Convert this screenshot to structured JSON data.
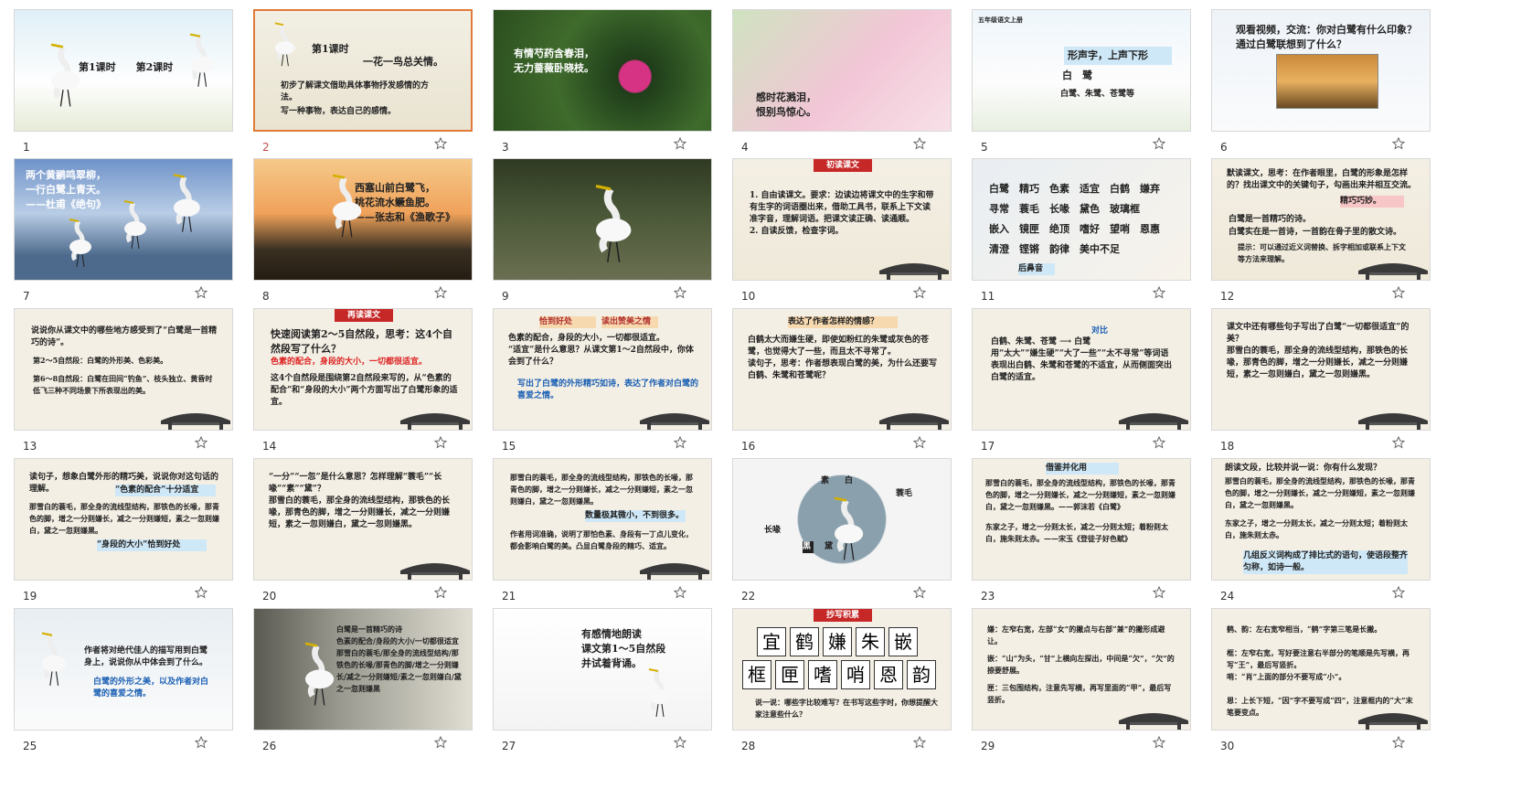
{
  "slides": [
    {
      "num": "1",
      "text": "第1课时　　第2课时"
    },
    {
      "num": "2",
      "title": "第1课时",
      "subtitle": "一花一鸟总关情。",
      "bullets": [
        "初步了解课文借助具体事物抒发感情的方法。",
        "写一种事物，表达自己的感情。"
      ]
    },
    {
      "num": "3",
      "text": "有情芍药含春泪，\n无力蔷薇卧晓枝。"
    },
    {
      "num": "4",
      "text": "感时花溅泪，\n恨别鸟惊心。"
    },
    {
      "num": "5",
      "header": "五年级语文上册",
      "tag": "形声字，上声下形",
      "item": "白　鹭",
      "sub": "白鹭、朱鹭、苍鹭等"
    },
    {
      "num": "6",
      "text": "观看视频，交流：你对白鹭有什么印象？通过白鹭联想到了什么？"
    },
    {
      "num": "7",
      "text": "两个黄鹂鸣翠柳，\n一行白鹭上青天。\n——杜甫《绝句》"
    },
    {
      "num": "8",
      "text": "西塞山前白鹭飞，\n桃花流水鳜鱼肥。\n——张志和《渔歌子》"
    },
    {
      "num": "9",
      "text": ""
    },
    {
      "num": "10",
      "banner": "初读课文",
      "text": "1. 自由读课文。要求：边读边将课文中的生字和带有生字的词语圈出来，借助工具书，联系上下文读准字音，理解词语。把课文读正确、读通顺。\n2. 自读反馈，检查字词。"
    },
    {
      "num": "11",
      "text": "白鹭　精巧　色素　适宜　白鹤　嫌弃\n寻常　蓑毛　长喙　黛色　玻璃框\n嵌入　镜匣　绝顶　嗜好　望哨　恩惠\n清澄　铿锵　韵律　美中不足",
      "tag": "后鼻音"
    },
    {
      "num": "12",
      "text": "默读课文，思考：在作者眼里，白鹭的形象是怎样的？找出课文中的关键句子，勾画出来并相互交流。",
      "tag": "精巧巧妙。",
      "bullets": [
        "白鹭是一首精巧的诗。",
        "白鹭实在是一首诗，一首韵在骨子里的散文诗。"
      ],
      "note": "提示：可以通过近义词替换、拆字相加或联系上下文等方法来理解。"
    },
    {
      "num": "13",
      "text": "说说你从课文中的哪些地方感受到了“白鹭是一首精巧的诗”。",
      "bullets": [
        "第2～5自然段：白鹭的外形美、色彩美。",
        "第6～8自然段：白鹭在田间“钓鱼”、枝头独立、黄昏时低飞三种不同场景下所表现出的美。"
      ]
    },
    {
      "num": "14",
      "banner": "再读课文",
      "text": "快速阅读第2～5自然段，思考：这4个自然段写了什么？",
      "red": "色素的配合，身段的大小，一切都很适宜。",
      "note": "这4个自然段是围绕第2自然段来写的，从“色素的配合”和“身段的大小”两个方面写出了白鹭形象的适宜。"
    },
    {
      "num": "15",
      "tags": [
        "恰到好处",
        "读出赞美之情"
      ],
      "text": "色素的配合，身段的大小，一切都很适宜。\n“适宜”是什么意思？从课文第1～2自然段中，你体会到了什么？",
      "note": "写出了白鹭的外形精巧如诗，表达了作者对白鹭的喜爱之情。"
    },
    {
      "num": "16",
      "tag": "表达了作者怎样的情感？",
      "text": "白鹤太大而嫌生硬，即使如粉红的朱鹭或灰色的苍鹭，也觉得大了一些，而且太不寻常了。\n读句子，思考：作者想表现白鹭的美，为什么还要写白鹤、朱鹭和苍鹭呢？"
    },
    {
      "num": "17",
      "tag": "对比",
      "text": "白鹤、朱鹭、苍鹭 ⟶ 白鹭\n用“太大”“嫌生硬”“大了一些”“太不寻常”等词语表现出白鹤、朱鹭和苍鹭的不适宜，从而侧面突出白鹭的适宜。"
    },
    {
      "num": "18",
      "text": "课文中还有哪些句子写出了白鹭“一切都很适宜”的美？\n那雪白的蓑毛，那全身的流线型结构，那铁色的长喙，那青色的脚，增之一分则嫌长，减之一分则嫌短，素之一忽则嫌白，黛之一忽则嫌黑。"
    },
    {
      "num": "19",
      "text": "读句子，想象白鹭外形的精巧美，说说你对这句话的理解。",
      "tag": "“色素的配合”十分适宜",
      "body": "那雪白的蓑毛，那全身的流线型结构，那铁色的长喙，那青色的脚，增之一分则嫌长，减之一分则嫌短，素之一忽则嫌白，黛之一忽则嫌黑。",
      "tag2": "“身段的大小”恰到好处"
    },
    {
      "num": "20",
      "text": "“一分”“一忽”是什么意思？怎样理解“蓑毛”“长喙”“素”“黛”？\n那雪白的蓑毛，那全身的流线型结构，那铁色的长喙，那青色的脚，增之一分则嫌长，减之一分则嫌短，素之一忽则嫌白，黛之一忽则嫌黑。"
    },
    {
      "num": "21",
      "text": "那雪白的蓑毛，那全身的流线型结构，那铁色的长喙，那青色的脚，增之一分则嫌长，减之一分则嫌短，素之一忽则嫌白，黛之一忽则嫌黑。",
      "tag": "数量极其微小，不到很多。",
      "note": "作者用词准确，说明了那怕色素、身段有一丁点儿变化，都会影响白鹭的美。凸显白鹭身段的精巧、适宜。"
    },
    {
      "num": "22",
      "labels": [
        "素",
        "白",
        "蓑毛",
        "长喙",
        "黑",
        "黛"
      ]
    },
    {
      "num": "23",
      "tag": "借鉴并化用",
      "bullets": [
        "那雪白的蓑毛，那全身的流线型结构，那铁色的长喙，那青色的脚，增之一分则嫌长，减之一分则嫌短，素之一忽则嫌白，黛之一忽则嫌黑。——郭沫若《白鹭》",
        "东家之子，增之一分则太长，减之一分则太短；着粉则太白，施朱则太赤。——宋玉《登徒子好色赋》"
      ]
    },
    {
      "num": "24",
      "text": "朗读文段，比较并说一说：你有什么发现？",
      "bullets": [
        "那雪白的蓑毛，那全身的流线型结构，那铁色的长喙，那青色的脚，增之一分则嫌长，减之一分则嫌短，素之一忽则嫌白，黛之一忽则嫌黑。",
        "东家之子，增之一分则太长，减之一分则太短；着粉则太白，施朱则太赤。"
      ],
      "note": "几组反义词构成了排比式的语句，使语段整齐匀称，如诗一般。"
    },
    {
      "num": "25",
      "text": "作者将对绝代佳人的描写用到白鹭身上，说说你从中体会到了什么。",
      "note": "白鹭的外形之美，以及作者对白鹭的喜爱之情。"
    },
    {
      "num": "26",
      "text": "白鹭是一首精巧的诗\n色素的配合/身段的大小/一切都很适宜\n那雪白的蓑毛/那全身的流线型结构/那铁色的长喙/那青色的脚/增之一分则嫌长/减之一分则嫌短/素之一忽则嫌白/黛之一忽则嫌黑"
    },
    {
      "num": "27",
      "text": "有感情地朗读\n课文第1～5自然段\n并试着背诵。"
    },
    {
      "num": "28",
      "banner": "抄写积累",
      "chars1": [
        "宜",
        "鹤",
        "嫌",
        "朱",
        "嵌"
      ],
      "chars2": [
        "框",
        "匣",
        "嗜",
        "哨",
        "恩",
        "韵"
      ],
      "text": "说一说：哪些字比较难写？在书写这些字时，你想提醒大家注意些什么？"
    },
    {
      "num": "29",
      "bullets": [
        "嫌：左窄右宽，左部“女”的撇点与右部“兼”的撇形成避让。",
        "嵌：“山”为头，“甘”上横向左探出，中间是“欠”，“欠”的捺要舒展。",
        "匣：三包围结构，注意先写横，再写里面的“甲”，最后写竖折。"
      ]
    },
    {
      "num": "30",
      "bullets": [
        "鹤、韵：左右宽窄相当，“鹤”字第三笔是长撇。",
        "框：左窄右宽，写好要注意右半部分的笔顺是先写横，再写“王”，最后写竖折。",
        "哨：“肖”上面的部分不要写成“小”。",
        "恩：上长下短，“因”字不要写成“四”，注意框内的“大”末笔要变点。"
      ]
    }
  ],
  "colors": {
    "selected": "#e07b39",
    "banner": "#c62828",
    "accent": "#d22222",
    "blue": "#1a5fb4"
  }
}
